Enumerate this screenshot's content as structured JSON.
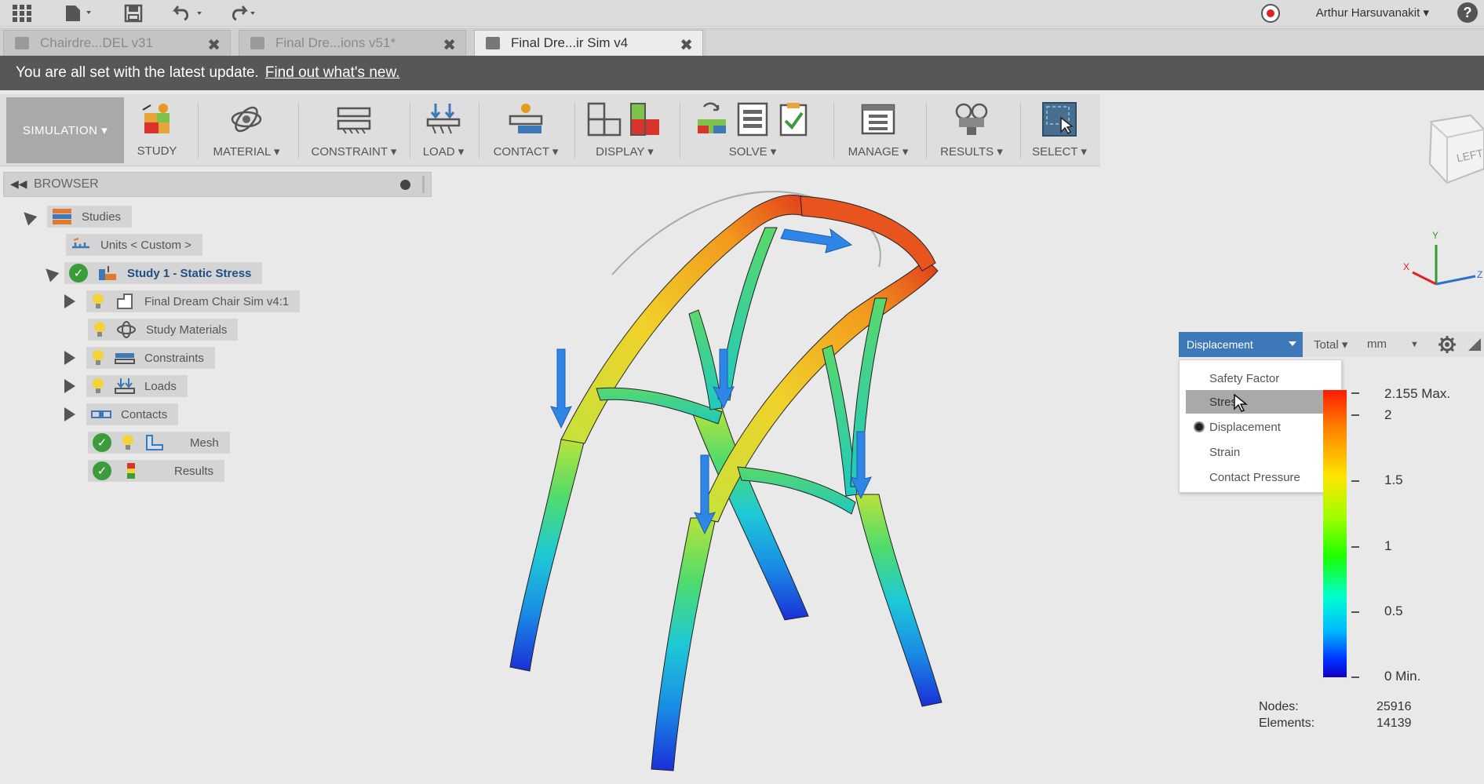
{
  "titlebar": {
    "user_name": "Arthur Harsuvanakit ▾",
    "help": "?"
  },
  "tabs": [
    {
      "label": "Chairdre...DEL v31",
      "close": "✖",
      "active": false
    },
    {
      "label": "Final Dre...ions v51*",
      "close": "✖",
      "active": false
    },
    {
      "label": "Final Dre...ir Sim v4",
      "close": "✖",
      "active": true
    }
  ],
  "banner": {
    "message": "You are all set with the latest update.",
    "link": "Find out what's new."
  },
  "ribbon": {
    "workspace": "SIMULATION ▾",
    "groups": [
      "STUDY",
      "MATERIAL ▾",
      "CONSTRAINT ▾",
      "LOAD ▾",
      "CONTACT ▾",
      "DISPLAY ▾",
      "SOLVE ▾",
      "MANAGE ▾",
      "RESULTS ▾",
      "SELECT ▾"
    ]
  },
  "browser": {
    "title": "BROWSER",
    "items": {
      "studies": "Studies",
      "units": "Units < Custom >",
      "study1": "Study 1 - Static Stress",
      "model": "Final Dream Chair Sim v4:1",
      "materials": "Study Materials",
      "constraints": "Constraints",
      "loads": "Loads",
      "contacts": "Contacts",
      "mesh": "Mesh",
      "results": "Results"
    }
  },
  "viewcube": {
    "face": "LEFT"
  },
  "triad": {
    "x": "X",
    "y": "Y",
    "z": "Z"
  },
  "legend": {
    "result_type": "Displacement",
    "component": "Total ▾",
    "unit": "mm",
    "menu": [
      "Safety Factor",
      "Stress",
      "Displacement",
      "Strain",
      "Contact Pressure"
    ],
    "selected": "Displacement",
    "hovered": "Stress",
    "ticks": [
      "2.155 Max.",
      "2",
      "1.5",
      "1",
      "0.5",
      "0 Min."
    ]
  },
  "stats": {
    "nodes_label": "Nodes:",
    "nodes_value": "25916",
    "elements_label": "Elements:",
    "elements_value": "14139"
  },
  "colors": {
    "accent": "#3d78b8",
    "banner": "#575757",
    "check": "#3b9c3b"
  }
}
